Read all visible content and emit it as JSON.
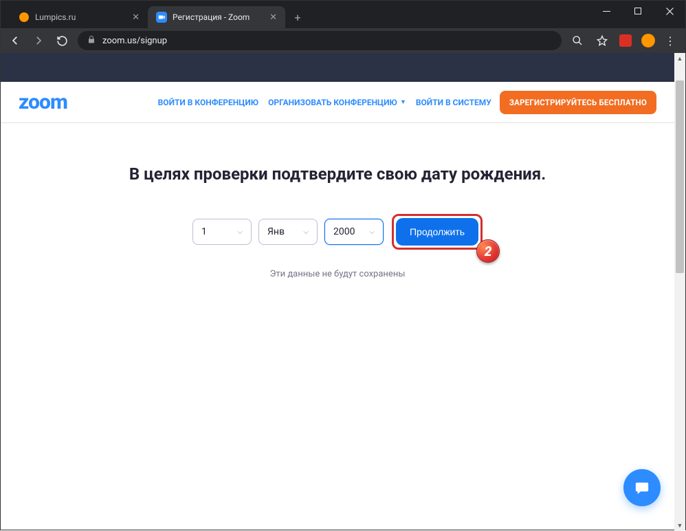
{
  "browser": {
    "tabs": [
      {
        "title": "Lumpics.ru",
        "active": false
      },
      {
        "title": "Регистрация - Zoom",
        "active": true
      }
    ],
    "url": "zoom.us/signup"
  },
  "header": {
    "logo": "zoom",
    "links": {
      "join": "ВОЙТИ В КОНФЕРЕНЦИЮ",
      "host": "ОРГАНИЗОВАТЬ КОНФЕРЕНЦИЮ",
      "signin": "ВОЙТИ В СИСТЕМУ"
    },
    "signup": "ЗАРЕГИСТРИРУЙТЕСЬ БЕСПЛАТНО"
  },
  "main": {
    "heading": "В целях проверки подтвердите свою дату рождения.",
    "day": "1",
    "month": "Янв",
    "year": "2000",
    "continue": "Продолжить",
    "disclaimer": "Эти данные не будут сохранены"
  },
  "annotations": {
    "step": "2"
  }
}
